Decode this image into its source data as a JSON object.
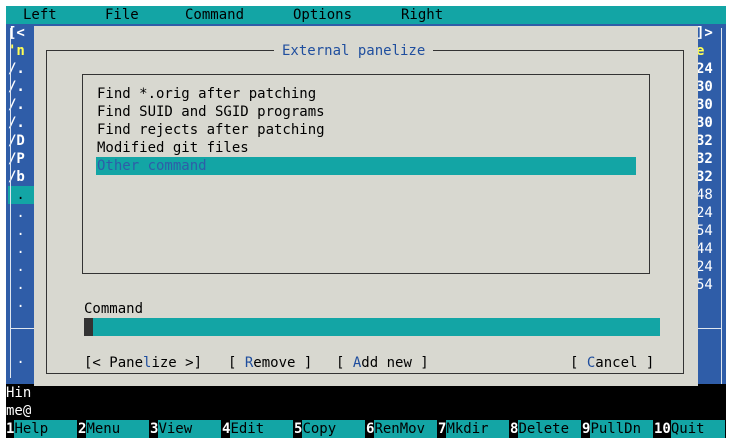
{
  "menubar": [
    "Left",
    "File",
    "Command",
    "Options",
    "Right"
  ],
  "left_panel": {
    "lines": [
      "[<",
      "'n",
      "/.",
      "/.",
      "/.",
      "/.",
      "/D",
      "/P",
      "/b",
      " .",
      " .",
      " .",
      " .",
      " .",
      " .",
      " ."
    ],
    "bottom": " ."
  },
  "right_panel": {
    "lines": [
      "]>",
      "e",
      "24",
      "30",
      "30",
      "30",
      "32",
      "32",
      "32",
      "48",
      "24",
      "54",
      "44",
      "24",
      "54"
    ],
    "bottom": "[^]"
  },
  "shell": [
    "Hin",
    "me@"
  ],
  "dialog": {
    "title": "External panelize",
    "items": [
      "Find *.orig after patching",
      "Find SUID and SGID programs",
      "Find rejects after patching",
      "Modified git files",
      "Other command"
    ],
    "selected_index": 4,
    "command_label": "Command",
    "command_value": "",
    "buttons": {
      "panelize": {
        "pre": "[< Pane",
        "hot": "l",
        "post": "ize >]"
      },
      "remove": {
        "pre": "[ ",
        "hot": "R",
        "post": "emove ]"
      },
      "add_new": {
        "pre": "[ ",
        "hot": "A",
        "post": "dd new ]"
      },
      "cancel": {
        "pre": "[ ",
        "hot": "C",
        "post": "ancel ]"
      }
    }
  },
  "keybar": [
    {
      "num": "1",
      "label": "Help"
    },
    {
      "num": "2",
      "label": "Menu"
    },
    {
      "num": "3",
      "label": "View"
    },
    {
      "num": "4",
      "label": "Edit"
    },
    {
      "num": "5",
      "label": "Copy"
    },
    {
      "num": "6",
      "label": "RenMov"
    },
    {
      "num": "7",
      "label": "Mkdir"
    },
    {
      "num": "8",
      "label": "Delete"
    },
    {
      "num": "9",
      "label": "PullDn"
    },
    {
      "num": "10",
      "label": "Quit"
    }
  ]
}
